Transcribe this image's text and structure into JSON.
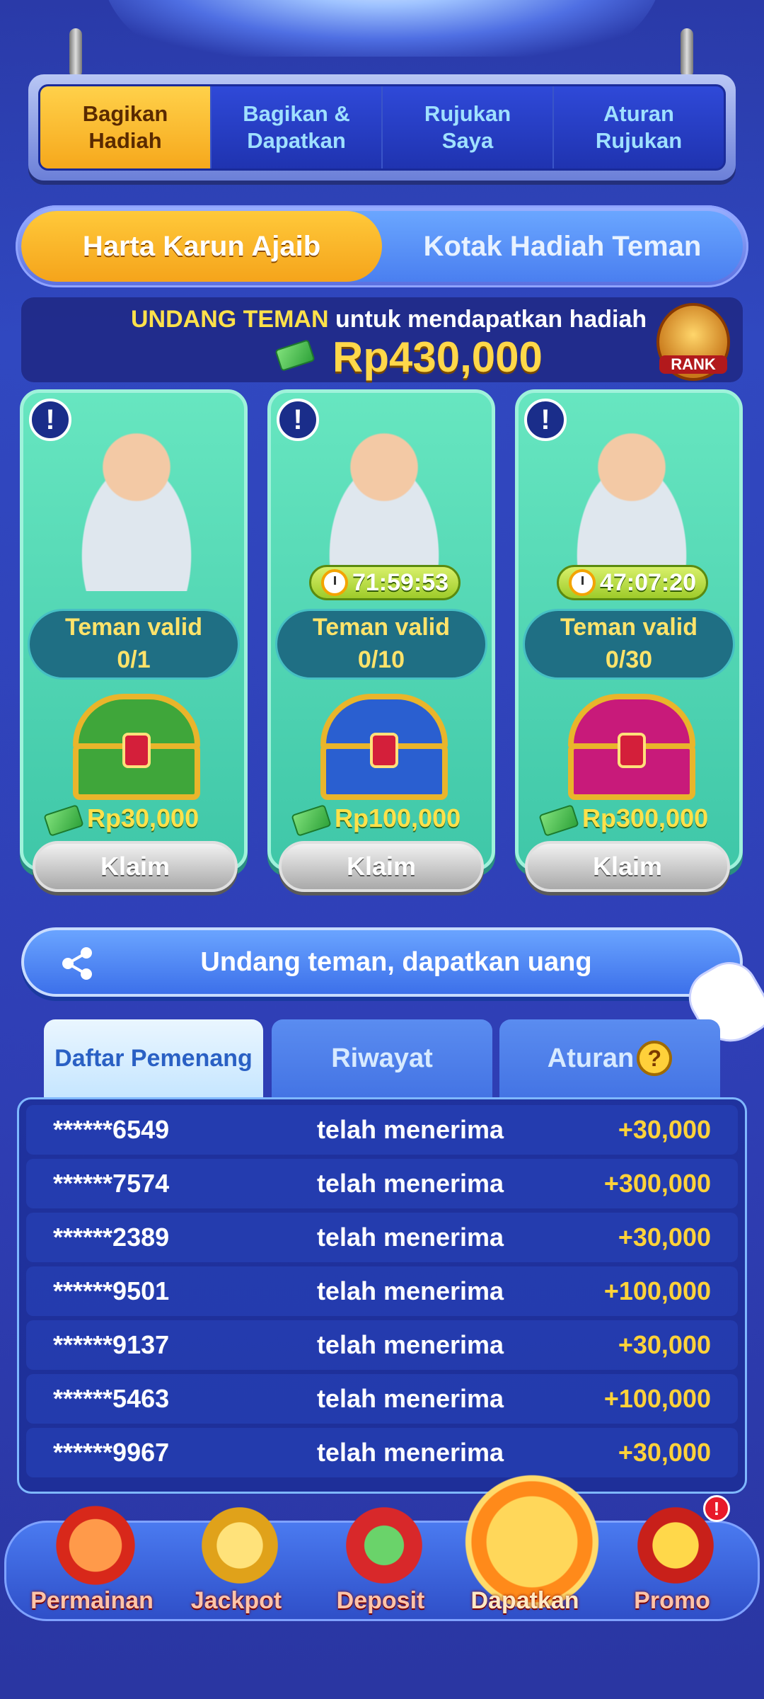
{
  "top_tabs": [
    {
      "label": "Bagikan\nHadiah",
      "active": true
    },
    {
      "label": "Bagikan &\nDapatkan",
      "active": false
    },
    {
      "label": "Rujukan\nSaya",
      "active": false
    },
    {
      "label": "Aturan\nRujukan",
      "active": false
    }
  ],
  "segment": {
    "left": "Harta Karun Ajaib",
    "right": "Kotak Hadiah Teman"
  },
  "invite": {
    "highlight": "UNDANG TEMAN",
    "text": " untuk mendapatkan hadiah",
    "amount": "Rp430,000",
    "rank_label": "RANK"
  },
  "cards": [
    {
      "timer": "",
      "valid_label": "Teman valid",
      "valid_count": "0/1",
      "reward": "Rp30,000",
      "claim": "Klaim",
      "chest_color": "#3fa63a"
    },
    {
      "timer": "71:59:53",
      "valid_label": "Teman valid",
      "valid_count": "0/10",
      "reward": "Rp100,000",
      "claim": "Klaim",
      "chest_color": "#2a5fd0"
    },
    {
      "timer": "47:07:20",
      "valid_label": "Teman valid",
      "valid_count": "0/30",
      "reward": "Rp300,000",
      "claim": "Klaim",
      "chest_color": "#c81a7a"
    }
  ],
  "share_button": "Undang teman, dapatkan uang",
  "lower_tabs": {
    "winners": "Daftar Pemenang",
    "history": "Riwayat",
    "rules": "Aturan"
  },
  "winners": [
    {
      "uid": "******6549",
      "action": "telah menerima",
      "amount": "+30,000"
    },
    {
      "uid": "******7574",
      "action": "telah menerima",
      "amount": "+300,000"
    },
    {
      "uid": "******2389",
      "action": "telah menerima",
      "amount": "+30,000"
    },
    {
      "uid": "******9501",
      "action": "telah menerima",
      "amount": "+100,000"
    },
    {
      "uid": "******9137",
      "action": "telah menerima",
      "amount": "+30,000"
    },
    {
      "uid": "******5463",
      "action": "telah menerima",
      "amount": "+100,000"
    },
    {
      "uid": "******9967",
      "action": "telah menerima",
      "amount": "+30,000"
    }
  ],
  "bottom_nav": [
    {
      "label": "Permainan",
      "icon": "slot-machine-icon"
    },
    {
      "label": "Jackpot",
      "icon": "trophy-icon"
    },
    {
      "label": "Deposit",
      "icon": "gift-basket-icon"
    },
    {
      "label": "Dapatkan",
      "icon": "handshake-icon",
      "active": true
    },
    {
      "label": "Promo",
      "icon": "treasure-chest-icon"
    }
  ],
  "promo_badge": "!"
}
